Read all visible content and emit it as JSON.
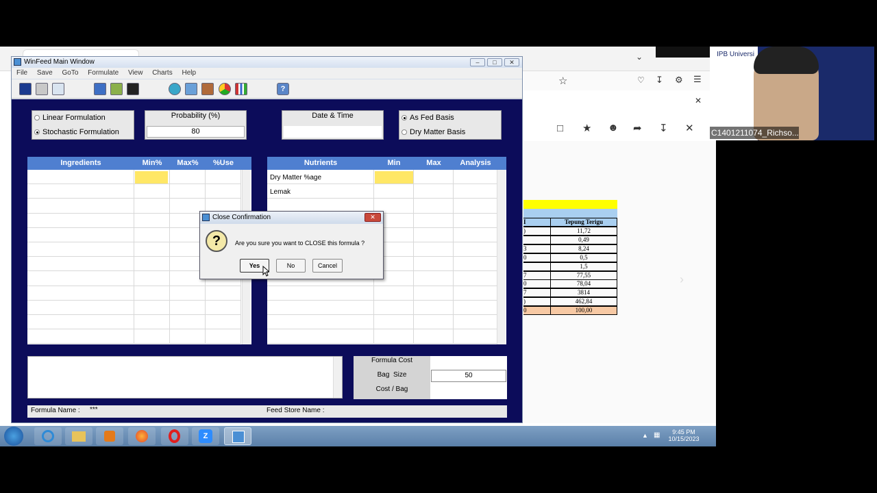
{
  "window": {
    "title": "WinFeed Main Window",
    "menu": [
      "File",
      "Save",
      "GoTo",
      "Formulate",
      "View",
      "Charts",
      "Help"
    ]
  },
  "formulation": {
    "linear": "Linear Formulation",
    "stochastic": "Stochastic Formulation",
    "selected": "stochastic"
  },
  "probability": {
    "label": "Probability (%)",
    "value": "80"
  },
  "datetime": {
    "label": "Date & Time",
    "value": ""
  },
  "basis": {
    "as_fed": "As Fed Basis",
    "dry_matter": "Dry Matter Basis",
    "selected": "as_fed"
  },
  "ingredients": {
    "headers": [
      "Ingredients",
      "Min%",
      "Max%",
      "%Use"
    ]
  },
  "nutrients": {
    "headers": [
      "Nutrients",
      "Min",
      "Max",
      "Analysis"
    ],
    "rows": [
      "Dry Matter %age",
      "Lemak"
    ]
  },
  "cost": {
    "formula_cost_label": "Formula Cost",
    "bag_size_label": "Bag  Size",
    "bag_size_value": "50",
    "cost_bag_label": "Cost / Bag"
  },
  "footer": {
    "formula_name_label": "Formula Name :",
    "formula_name_value": "***",
    "feed_store_label": "Feed Store Name :"
  },
  "dialog": {
    "title": "Close Confirmation",
    "message": "Are you sure you want to CLOSE this formula ?",
    "yes": "Yes",
    "no": "No",
    "cancel": "Cancel"
  },
  "sheet": {
    "header": "Tepung Terigu",
    "rows": [
      {
        "l": ")",
        "r": "11,72"
      },
      {
        "l": "",
        "r": "0,49"
      },
      {
        "l": "3",
        "r": "8,24"
      },
      {
        "l": "0",
        "r": "0,5"
      },
      {
        "l": "",
        "r": "1,5"
      },
      {
        "l": "7",
        "r": "77,55"
      },
      {
        "l": "0",
        "r": "78,04"
      },
      {
        "l": "7",
        "r": "3814"
      },
      {
        "l": ")",
        "r": "462,84"
      },
      {
        "l": "0",
        "r": "100,00"
      }
    ]
  },
  "cam": {
    "label": "C1401211074_Richso...",
    "logo": "IPB Universi"
  },
  "clock": {
    "time": "9:45 PM",
    "date": "10/15/2023"
  },
  "colors": {
    "window_bg": "#0c0c5a",
    "header_blue": "#4f7fd0",
    "highlight_yellow": "#ffe766"
  }
}
